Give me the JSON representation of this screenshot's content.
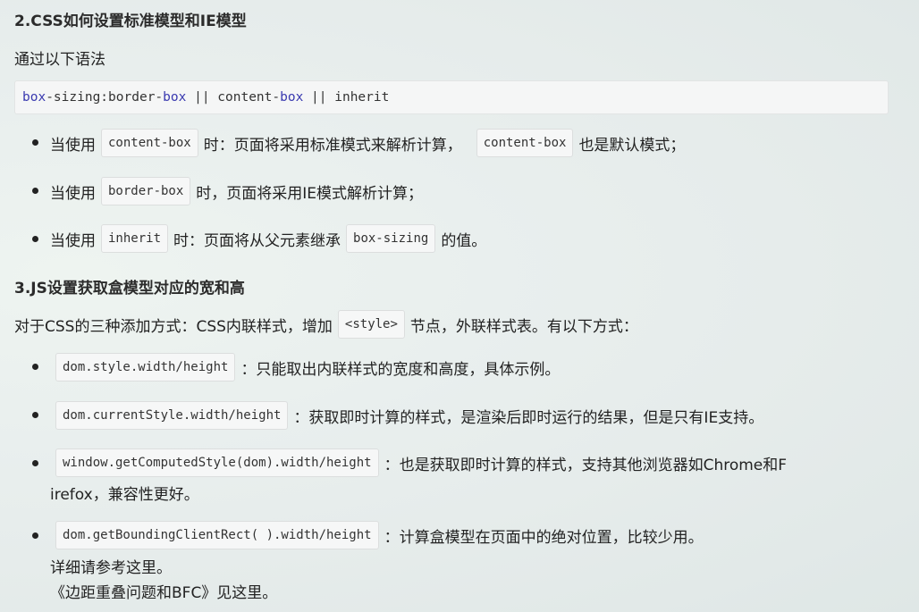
{
  "section2": {
    "heading": "2.CSS如何设置标准模型和IE模型",
    "intro": "通过以下语法",
    "code": {
      "p1": "box",
      "p2": "-sizing:border-",
      "p3": "box",
      "p4": " || content-",
      "p5": "box",
      "p6": " || inherit"
    },
    "items": [
      {
        "pre": "当使用",
        "code1": "content-box",
        "mid": "时：页面将采用标准模式来解析计算，",
        "code2": "content-box",
        "post": "也是默认模式；"
      },
      {
        "pre": "当使用",
        "code1": "border-box",
        "post": "时，页面将采用IE模式解析计算；"
      },
      {
        "pre": "当使用",
        "code1": "inherit",
        "mid": "时：页面将从父元素继承",
        "code2": "box-sizing",
        "post": "的值。"
      }
    ]
  },
  "section3": {
    "heading": "3.JS设置获取盒模型对应的宽和高",
    "intro_pre": "对于CSS的三种添加方式：CSS内联样式，增加",
    "intro_code": "<style>",
    "intro_post": "节点，外联样式表。有以下方式：",
    "items": [
      {
        "code": "dom.style.width/height",
        "text": "：只能取出内联样式的宽度和高度，具体示例。"
      },
      {
        "code": "dom.currentStyle.width/height",
        "text": "：获取即时计算的样式，是渲染后即时运行的结果，但是只有IE支持。"
      },
      {
        "code": "window.getComputedStyle(dom).width/height",
        "text": "：也是获取即时计算的样式，支持其他浏览器如Chrome和F",
        "text2": "irefox，兼容性更好。"
      },
      {
        "code": "dom.getBoundingClientRect( ).width/height",
        "text": "：计算盒模型在页面中的绝对位置，比较少用。",
        "line2": "详细请参考这里。",
        "line3": "《边距重叠问题和BFC》见这里。"
      }
    ]
  }
}
